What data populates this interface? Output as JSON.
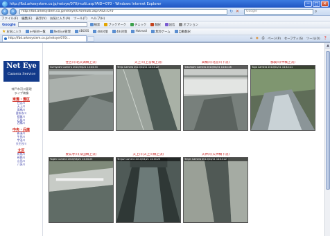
{
  "window": {
    "title": "http://fbd.arkesystem.co.jp/netsye/070/multi.asp?AID=070 - Windows Internet Explorer",
    "min_glyph": "─",
    "max_glyph": "□",
    "close_glyph": "✕"
  },
  "addressbar": {
    "url": "http://fbd.arkesystem.co.jp/netsye/070/multi.asp?AID=070",
    "search_placeholder": "Google"
  },
  "menu": [
    "ファイル(F)",
    "編集(E)",
    "表示(V)",
    "お気に入り(A)",
    "ツール(T)",
    "ヘルプ(H)"
  ],
  "googlebar": {
    "label": "Google",
    "tools": [
      "検索",
      "ブックマーク",
      "チェック",
      "翻訳",
      "送信",
      "オプション"
    ]
  },
  "favorites": {
    "label": "お気に入り",
    "items": [
      "e-NEW一覧",
      "NetEye管理",
      "4BOSS",
      "4BI対策",
      "4BI対策",
      "Hotmail",
      "無料ゲーム",
      "自動翻訳"
    ]
  },
  "tab": {
    "label": "http://fbd.arkesystem.co.jp/netsye/070/..."
  },
  "commandbar": [
    "ページ(P)",
    "セーフティ(S)",
    "ツール(O)"
  ],
  "sidebar": {
    "logo_line1": "Net Eye",
    "logo_line2": "Camera Service",
    "header_lines": [
      "神戸市河川管理",
      "ライブ映像"
    ],
    "sections": [
      {
        "title": "東灘・灘区",
        "links": [
          "住吉川",
          "天上川",
          "高橋川",
          "要玄寺川",
          "都賀川",
          "石屋川",
          "西郷川"
        ]
      },
      {
        "title": "中央・兵庫",
        "links": [
          "新湊川",
          "生田川",
          "宇治川",
          "天王谷川"
        ]
      },
      {
        "title": "北区",
        "links": [
          "有馬川",
          "有野川",
          "山田川",
          "八多川"
        ]
      }
    ]
  },
  "cameras": [
    {
      "title": "住吉川(北天満橋上流)",
      "timestamp": "Sumiyoshi Camera 2010/04/21 14:44:33"
    },
    {
      "title": "天上川(上宮橋上流)",
      "timestamp": "Tenjo Camera 2010/04/21 14:44:22"
    },
    {
      "title": "高橋川(北宮川下流)",
      "timestamp": "Takahashi Camera 2010/04/21 14:44:26"
    },
    {
      "title": "都賀川(甲橋上流)",
      "timestamp": "Toga Camera 2010/04/21 14:44:21"
    },
    {
      "title": "要玄寺川(深田橋上流)",
      "timestamp": "Yogen Camera 2010/04/21 14:44:25"
    },
    {
      "title": "天上川(天上川橋上流)",
      "timestamp": "Tenjo2 Camera 2010/04/21 14:44:20"
    },
    {
      "title": "天神川(天神橋下流)",
      "timestamp": "Tenjin Camera 2010/04/21 14:44:22"
    }
  ],
  "colors": {
    "accent_title": "#c81f1f",
    "sidebar_section": "#d0261b",
    "logo_bg": "#123a8a"
  }
}
